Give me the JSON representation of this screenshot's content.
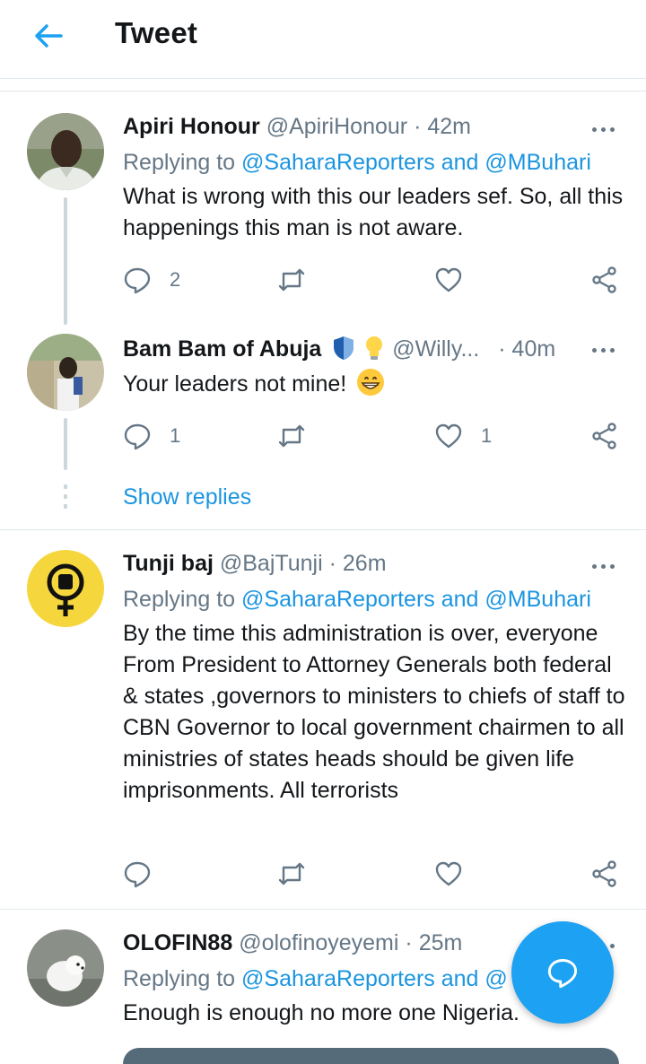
{
  "header": {
    "title": "Tweet"
  },
  "tweets": [
    {
      "name": "Apiri Honour",
      "handle": "@ApiriHonour",
      "dot": "·",
      "time": "42m",
      "replying_prefix": "Replying to ",
      "replying_to_1": "@SaharaReporters",
      "replying_and": " and ",
      "replying_to_2": "@MBuhari",
      "text": "What is wrong with this our leaders sef. So, all this happenings this man is not aware.",
      "reply_count": "2",
      "retweet_count": "",
      "like_count": ""
    },
    {
      "name": "Bam Bam of Abuja",
      "handle": "@Willy...",
      "dot": "·",
      "time": "40m",
      "text": "Your leaders not mine!",
      "reply_count": "1",
      "retweet_count": "",
      "like_count": "1"
    },
    {
      "name": "Tunji baj",
      "handle": "@BajTunji",
      "dot": "·",
      "time": "26m",
      "replying_prefix": "Replying to ",
      "replying_to_1": "@SaharaReporters",
      "replying_and": " and ",
      "replying_to_2": "@MBuhari",
      "text": "By the time this administration is over, everyone From President to Attorney Generals both federal & states ,governors to ministers to chiefs of staff to CBN Governor to local government chairmen to all ministries of states heads should be given life imprisonments. All terrorists",
      "reply_count": "",
      "retweet_count": "",
      "like_count": ""
    },
    {
      "name": "OLOFIN88",
      "handle": "@olofinoyeyemi",
      "dot": "·",
      "time": "25m",
      "replying_prefix": "Replying to ",
      "replying_to_1": "@SaharaReporters",
      "replying_and": " and ",
      "replying_to_2": "@",
      "text": "Enough is enough no more one Nigeria."
    }
  ],
  "show_replies": "Show replies",
  "colors": {
    "accent": "#1da1f2",
    "link": "#1b95e0",
    "muted": "#657786",
    "divider": "#e1e8ed"
  },
  "icons": [
    "back-arrow-icon",
    "more-icon",
    "reply-icon",
    "retweet-icon",
    "like-icon",
    "share-icon",
    "compose-reply-icon"
  ]
}
